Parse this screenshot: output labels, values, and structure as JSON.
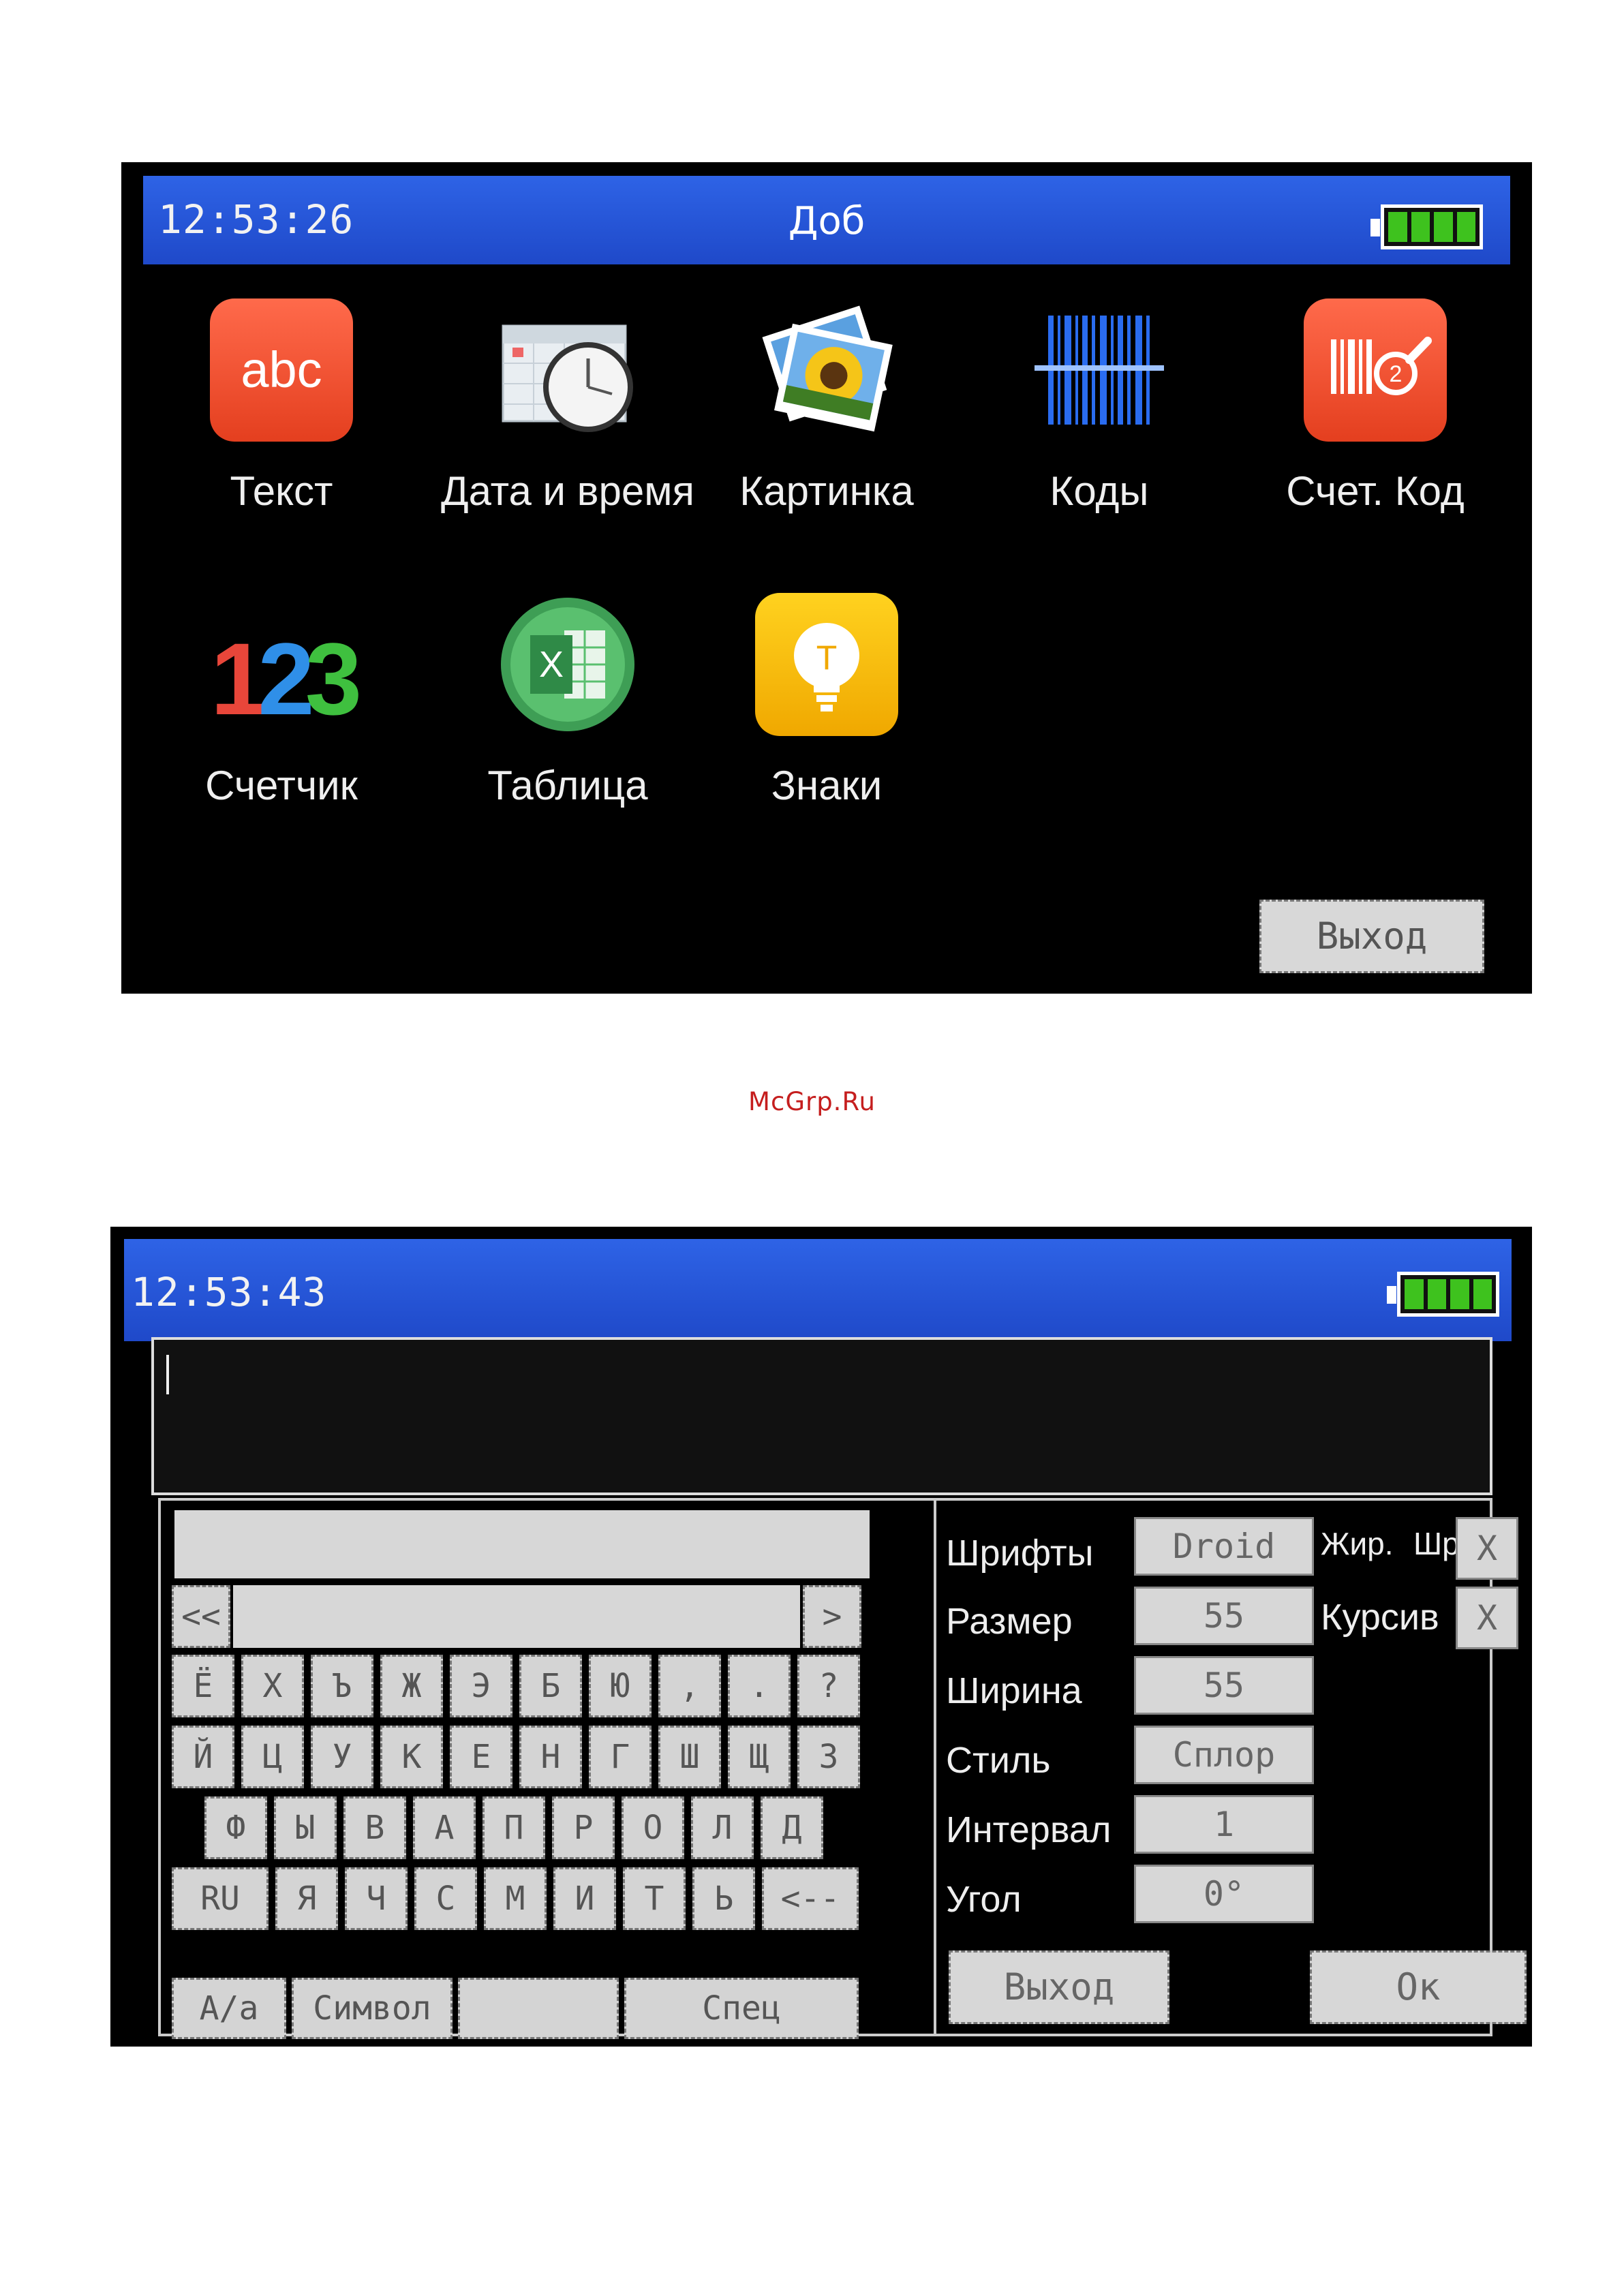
{
  "screen1": {
    "clock": "12:53:26",
    "title": "Доб",
    "apps": [
      {
        "label": "Текст",
        "icon": "abc-text-icon",
        "glyph": "abc"
      },
      {
        "label": "Дата  и  время",
        "icon": "calendar-clock-icon"
      },
      {
        "label": "Картинка",
        "icon": "picture-sunflower-icon"
      },
      {
        "label": "Коды",
        "icon": "barcode-icon"
      },
      {
        "label": "Счет. Код",
        "icon": "counter-barcode-icon"
      },
      {
        "label": "Счетчик",
        "icon": "counter-123-icon",
        "glyph": [
          "1",
          "2",
          "3"
        ]
      },
      {
        "label": "Таблица",
        "icon": "excel-table-icon",
        "glyph": "X"
      },
      {
        "label": "Знаки",
        "icon": "lightbulb-signs-icon",
        "glyph": "T"
      }
    ],
    "exit_label": "Выход"
  },
  "watermark": "McGrp.Ru",
  "screen2": {
    "clock": "12:53:43",
    "keyboard": {
      "nav_left": "<<",
      "nav_right": ">",
      "row1": [
        "Ё",
        "Х",
        "Ъ",
        "Ж",
        "Э",
        "Б",
        "Ю",
        ",",
        ".",
        "?"
      ],
      "row2": [
        "Й",
        "Ц",
        "У",
        "К",
        "Е",
        "Н",
        "Г",
        "Ш",
        "Щ",
        "З"
      ],
      "row3": [
        "Ф",
        "Ы",
        "В",
        "А",
        "П",
        "Р",
        "О",
        "Л",
        "Д"
      ],
      "row4": [
        "RU",
        "Я",
        "Ч",
        "С",
        "М",
        "И",
        "Т",
        "Ь",
        "<--"
      ],
      "row5": [
        "A/a",
        "Символ",
        "",
        "Спец"
      ]
    },
    "panel": {
      "fonts_label": "Шрифты",
      "fonts_value": "Droid",
      "size_label": "Размер",
      "size_value": "55",
      "width_label": "Ширина",
      "width_value": "55",
      "style_label": "Стиль",
      "style_value": "Сплор",
      "interval_label": "Интервал",
      "interval_value": "1",
      "angle_label": "Угол",
      "angle_value": "0°",
      "bold_label": "Жир.",
      "bold_extra": "Шр",
      "bold_value": "X",
      "italic_label": "Курсив",
      "italic_value": "X",
      "exit_label": "Выход",
      "ok_label": "Ок"
    }
  },
  "colors": {
    "titlebar": "#2755d8",
    "battery": "#3ec21e",
    "screen_bg": "#000000",
    "watermark": "#c51e1e"
  }
}
